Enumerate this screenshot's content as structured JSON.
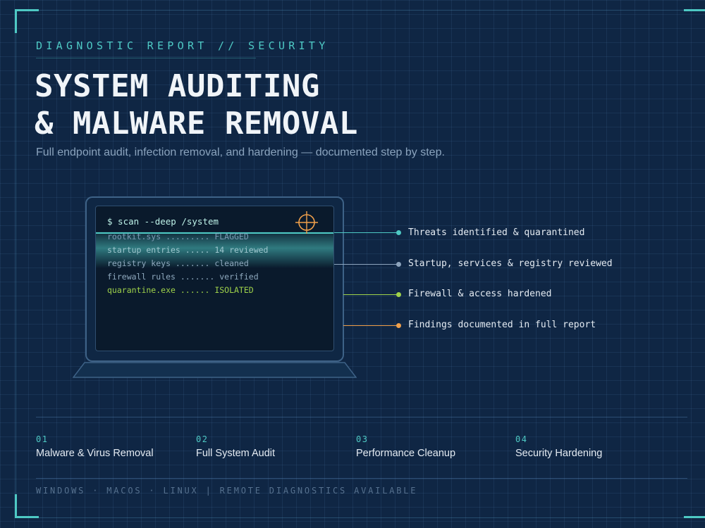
{
  "header": {
    "eyebrow": "DIAGNOSTIC REPORT // SECURITY",
    "title_line1": "SYSTEM AUDITING",
    "title_line2": "& MALWARE REMOVAL",
    "subtitle": "Full endpoint audit, infection removal, and hardening — documented step by step."
  },
  "terminal": {
    "command": "$ scan --deep /system",
    "lines": [
      "rootkit.sys ......... FLAGGED",
      "startup entries ..... 14 reviewed",
      "registry keys ....... cleaned",
      "firewall rules ....... verified",
      "quarantine.exe ...... ISOLATED"
    ]
  },
  "callouts": [
    {
      "text": "Threats identified & quarantined",
      "color": "#4ec9c4"
    },
    {
      "text": "Startup, services & registry reviewed",
      "color": "#8da4bd"
    },
    {
      "text": "Firewall & access hardened",
      "color": "#9fd24a"
    },
    {
      "text": "Findings documented in full report",
      "color": "#f0a04b"
    }
  ],
  "services": [
    {
      "num": "01",
      "name": "Malware & Virus Removal"
    },
    {
      "num": "02",
      "name": "Full System Audit"
    },
    {
      "num": "03",
      "name": "Performance Cleanup"
    },
    {
      "num": "04",
      "name": "Security Hardening"
    }
  ],
  "footer": "WINDOWS · MACOS · LINUX | REMOTE DIAGNOSTICS AVAILABLE",
  "icons": {
    "crosshair": "crosshair-icon"
  },
  "colors": {
    "accent": "#4ec9c4",
    "background": "#0f2644",
    "warning": "#f0a04b",
    "success": "#9fd24a"
  }
}
